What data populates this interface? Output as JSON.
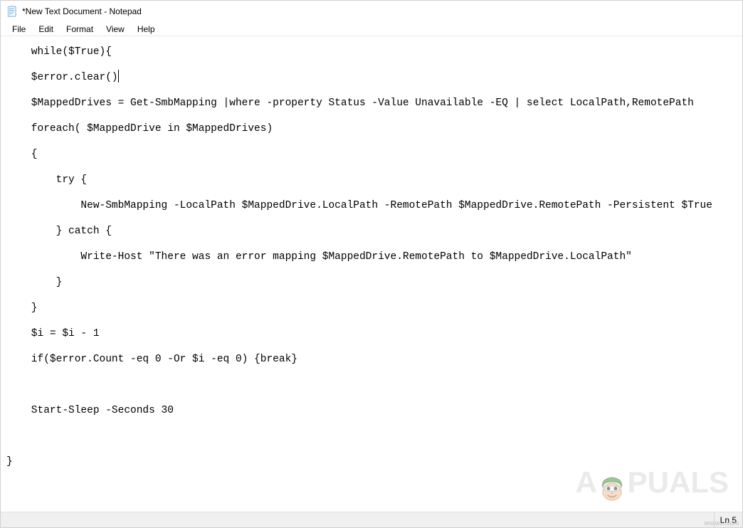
{
  "title_bar": {
    "title": "*New Text Document - Notepad"
  },
  "menu": {
    "items": [
      "File",
      "Edit",
      "Format",
      "View",
      "Help"
    ]
  },
  "editor": {
    "content": "    while($True){\n    $error.clear()\n    $MappedDrives = Get-SmbMapping |where -property Status -Value Unavailable -EQ | select LocalPath,RemotePath\n    foreach( $MappedDrive in $MappedDrives)\n    {\n        try {\n            New-SmbMapping -LocalPath $MappedDrive.LocalPath -RemotePath $MappedDrive.RemotePath -Persistent $True\n        } catch {\n            Write-Host \"There was an error mapping $MappedDrive.RemotePath to $MappedDrive.LocalPath\"\n        }\n    }\n    $i = $i - 1\n    if($error.Count -eq 0 -Or $i -eq 0) {break}\n\n    Start-Sleep -Seconds 30\n\n}",
    "caret_line_index": 1
  },
  "status_bar": {
    "position": "Ln 5"
  },
  "watermark": {
    "text_before": "A",
    "text_after": "PUALS"
  },
  "credit": "wsxwin.com"
}
